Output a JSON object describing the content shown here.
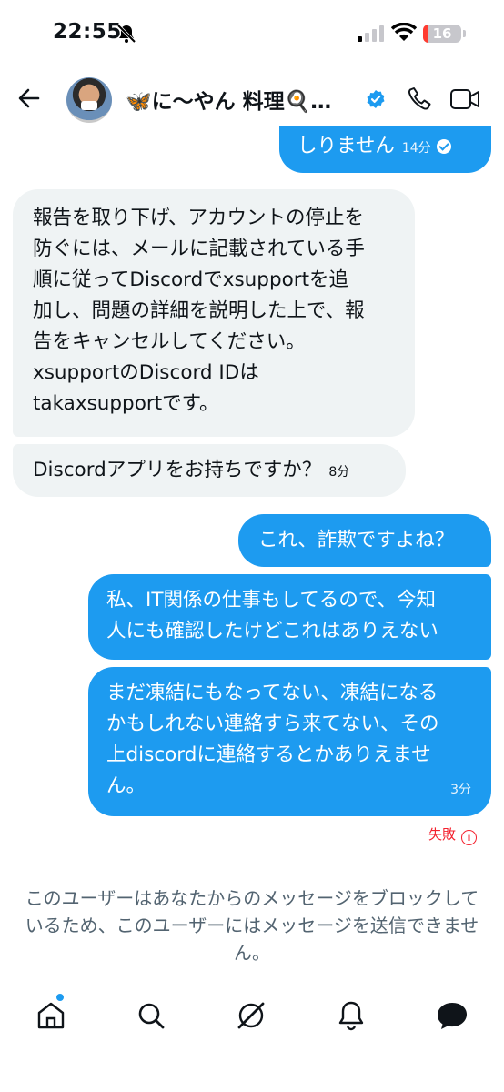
{
  "status_bar": {
    "time": "22:55",
    "battery_level": "16"
  },
  "header": {
    "contact_name": "🦋に〜やん 料理🍳…",
    "verified": true
  },
  "messages": [
    {
      "side": "sent",
      "text": "しりません",
      "time": "14分",
      "read": true
    },
    {
      "side": "received",
      "lines": [
        "報告を取り下げ、アカウントの停止を",
        "防ぐには、メールに記載されている手",
        "順に従ってDiscordでxsupportを追",
        "加し、問題の詳細を説明した上で、報",
        "告をキャンセルしてください。",
        "xsupportのDiscord IDは",
        "takaxsupportです。"
      ]
    },
    {
      "side": "received",
      "text": "Discordアプリをお持ちですか？",
      "time": "8分"
    },
    {
      "side": "sent",
      "text": "これ、詐欺ですよね？"
    },
    {
      "side": "sent",
      "lines": [
        "私、IT関係の仕事もしてるので、今知",
        "人にも確認したけどこれはありえない"
      ]
    },
    {
      "side": "sent",
      "lines": [
        "まだ凍結にもなってない、凍結になる",
        "かもしれない連絡すら来てない、その",
        "上discordに連絡するとかありえませ",
        "ん。"
      ],
      "time": "3分"
    }
  ],
  "failed_label": "失敗",
  "blocked_notice": "このユーザーはあなたからのメッセージをブロックしているため、このユーザーにはメッセージを送信できません。",
  "colors": {
    "accent": "#1d9bf0",
    "received_bubble": "#eff3f4",
    "error": "#f4212e"
  },
  "tabs": [
    "home-icon",
    "search-icon",
    "grok-icon",
    "notifications-icon",
    "messages-icon"
  ]
}
